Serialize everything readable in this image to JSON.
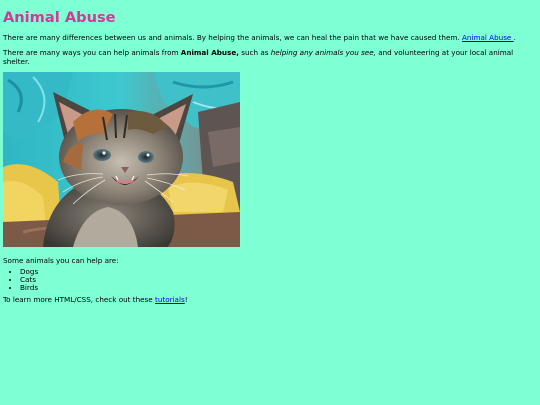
{
  "page": {
    "title": "Animal Abuse",
    "intro": {
      "text": "There are many differences between us and animals. By helping the animals, we can heal the pain that we have caused them. ",
      "link_label": "Animal Abuse "
    },
    "ways": {
      "prefix": "There are many ways you can help animals from ",
      "bold": "Animal Abuse,",
      "middle": " such as ",
      "italic": "helping any animals you see,",
      "suffix": " and volunteering at your local animal shelter."
    },
    "image": {
      "alt": "Animal Abuse",
      "icon": "kitten-photo"
    },
    "list_intro": "Some animals you can help are:",
    "animals": [
      "Dogs",
      "Cats",
      "Birds"
    ],
    "outro": {
      "prefix": "To learn more HTML/CSS, check out these ",
      "link_label": "tutorials",
      "suffix": "!"
    }
  },
  "colors": {
    "background": "#7fffd4",
    "title": "#d2399a",
    "link": "#0000ee"
  }
}
